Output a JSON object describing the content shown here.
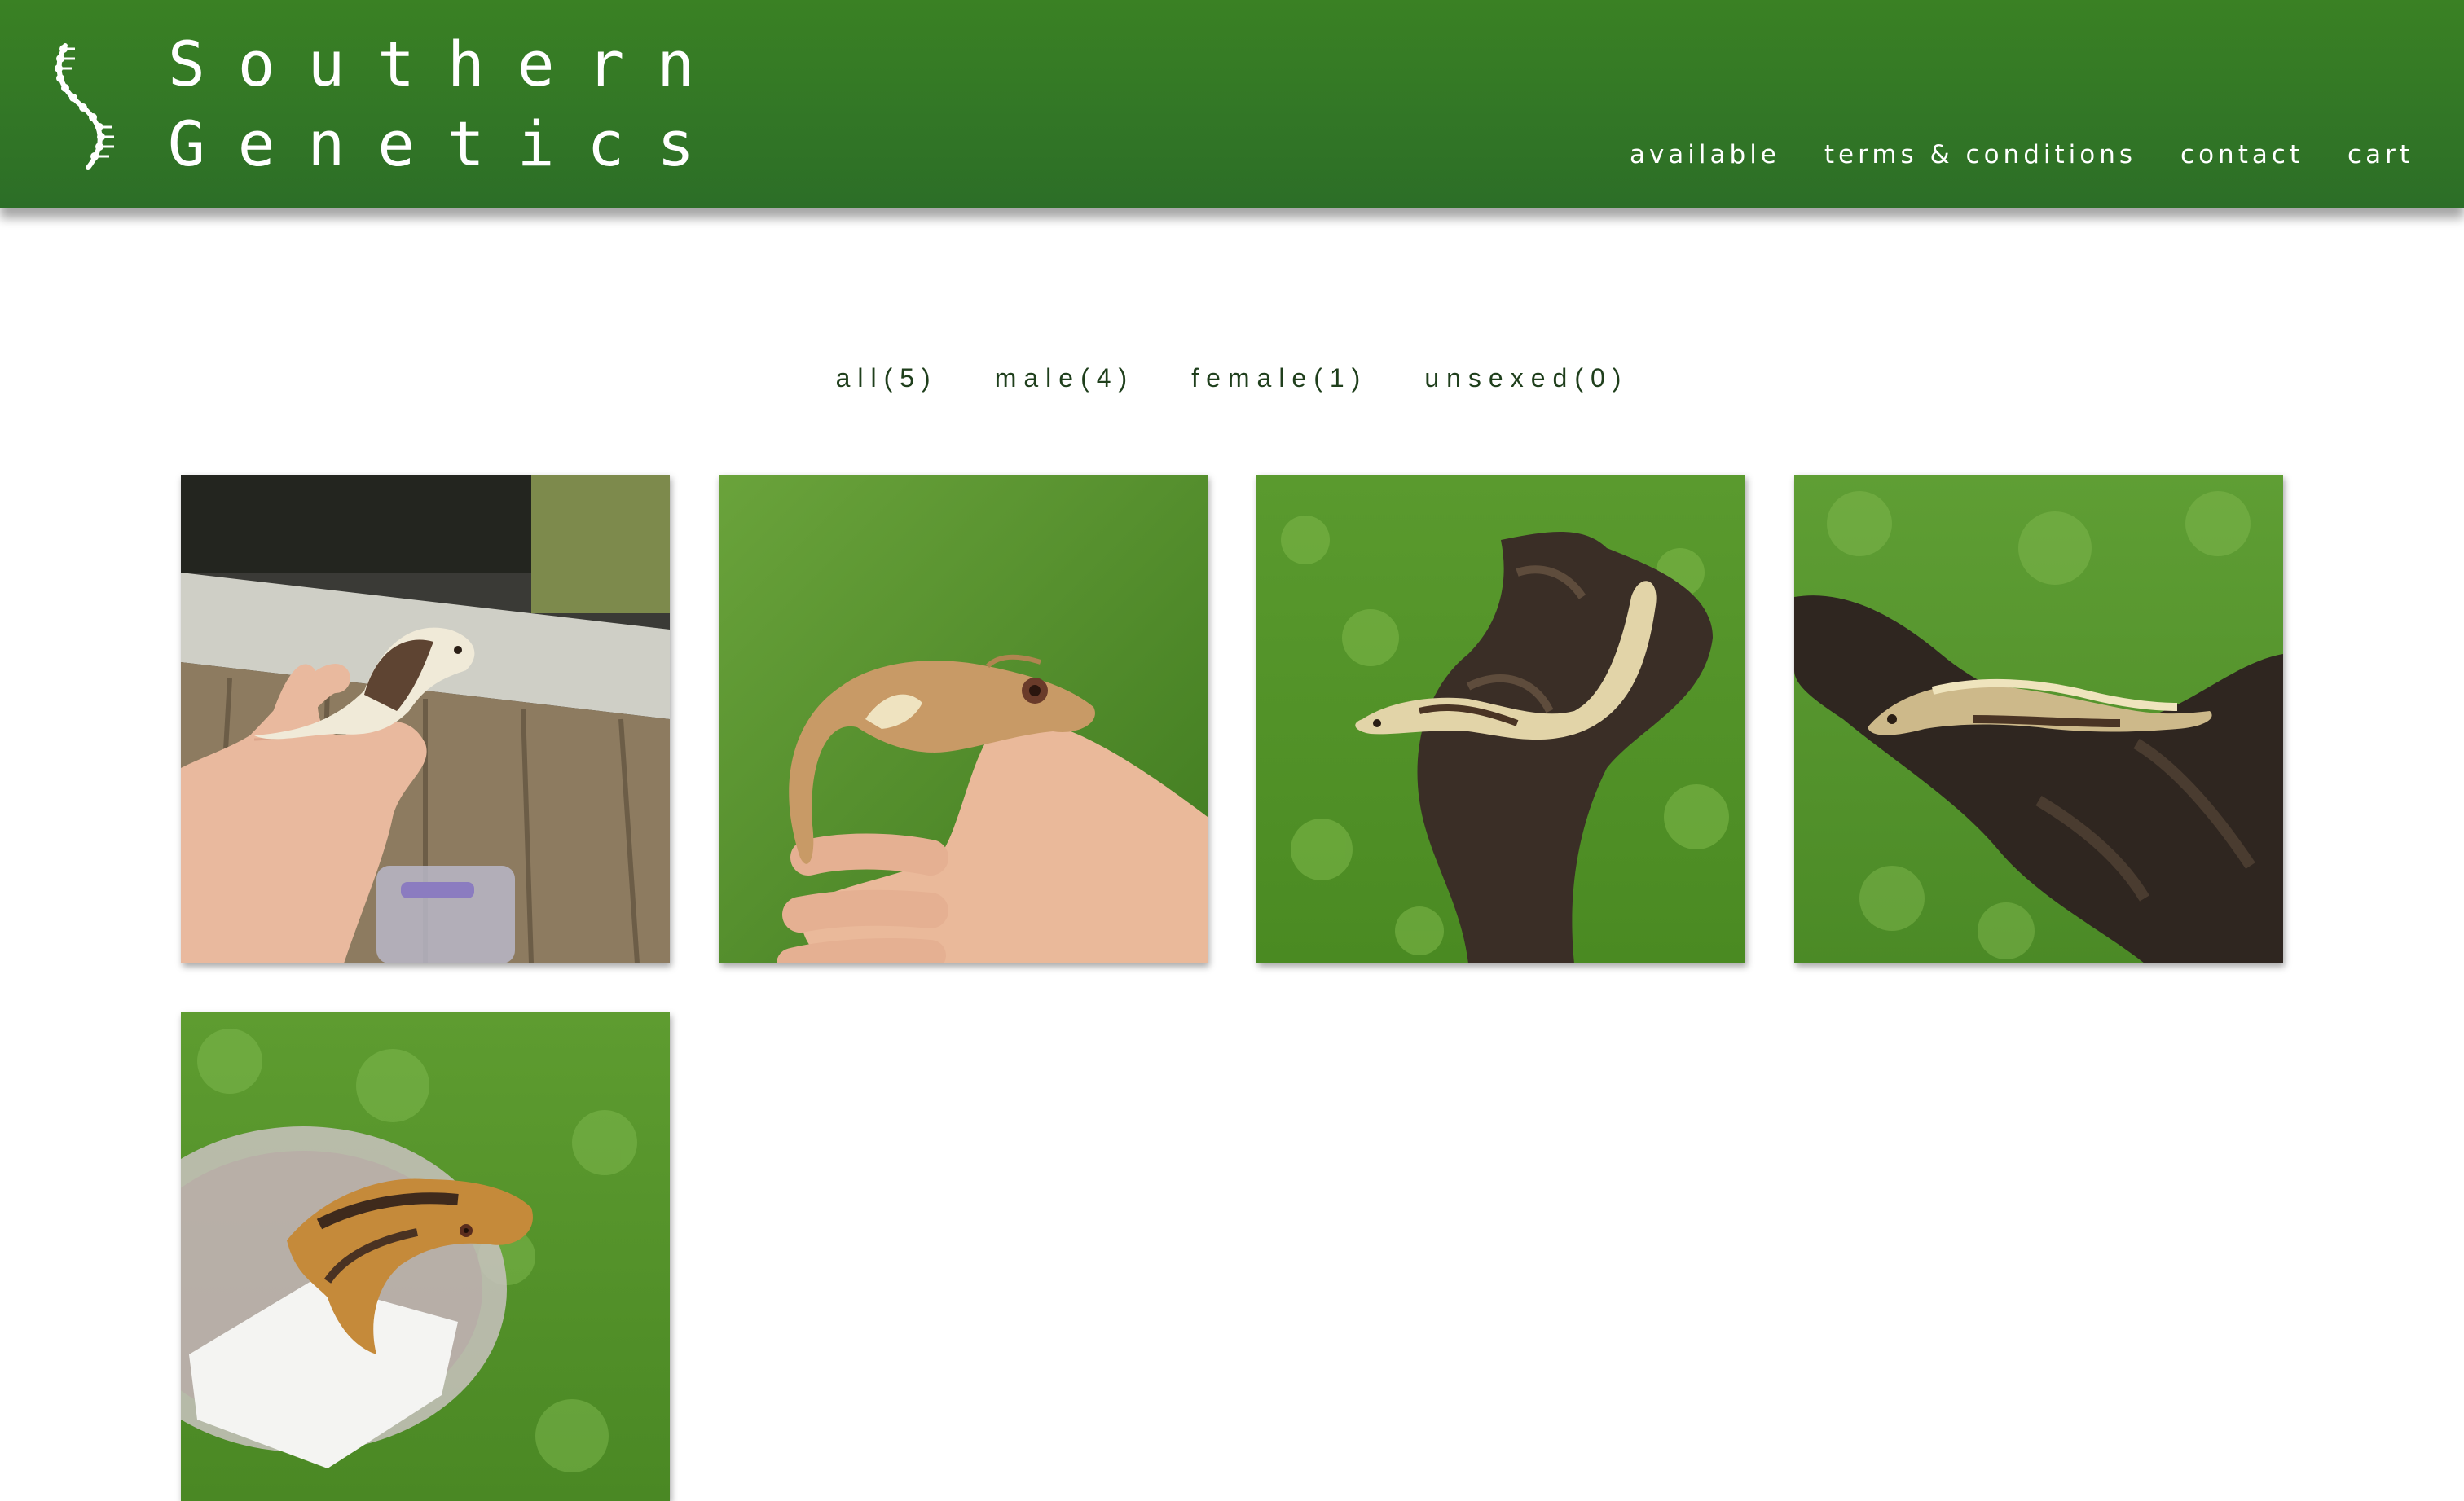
{
  "brand": {
    "line1": "Southern",
    "line2": "Genetics"
  },
  "nav": [
    {
      "label": "available"
    },
    {
      "label": "terms & conditions"
    },
    {
      "label": "contact"
    },
    {
      "label": "cart"
    }
  ],
  "filters": [
    {
      "label": "all",
      "count": "5"
    },
    {
      "label": "male",
      "count": "4"
    },
    {
      "label": "female",
      "count": "1"
    },
    {
      "label": "unsexed",
      "count": "0"
    }
  ],
  "colors": {
    "header_top": "#3a8124",
    "header_bottom": "#2c6e27",
    "filter_text": "#1f3f1c",
    "grass": "#4f8a2a"
  },
  "gallery": [
    {
      "scene": "gecko on hand over wooden deck"
    },
    {
      "scene": "gecko on hand over grass"
    },
    {
      "scene": "gecko on driftwood over grass"
    },
    {
      "scene": "gecko on driftwood branch over grass"
    },
    {
      "scene": "gecko on deli cup over grass"
    }
  ]
}
